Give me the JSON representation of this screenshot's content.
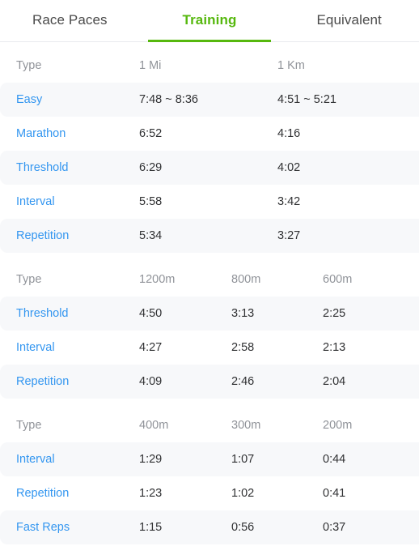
{
  "tabs": [
    {
      "label": "Race Paces",
      "active": false
    },
    {
      "label": "Training",
      "active": true
    },
    {
      "label": "Equivalent",
      "active": false
    }
  ],
  "colors": {
    "accent_green": "#56b80e",
    "link_blue": "#3396f0",
    "header_gray": "#909399",
    "value_dark": "#303133",
    "row_shaded": "#f7f8fa"
  },
  "tables": [
    {
      "columns": 2,
      "headers": [
        "Type",
        "1 Mi",
        "1 Km"
      ],
      "rows": [
        {
          "type": "Easy",
          "values": [
            "7:48 ~ 8:36",
            "4:51 ~ 5:21"
          ]
        },
        {
          "type": "Marathon",
          "values": [
            "6:52",
            "4:16"
          ]
        },
        {
          "type": "Threshold",
          "values": [
            "6:29",
            "4:02"
          ]
        },
        {
          "type": "Interval",
          "values": [
            "5:58",
            "3:42"
          ]
        },
        {
          "type": "Repetition",
          "values": [
            "5:34",
            "3:27"
          ]
        }
      ]
    },
    {
      "columns": 3,
      "headers": [
        "Type",
        "1200m",
        "800m",
        "600m"
      ],
      "rows": [
        {
          "type": "Threshold",
          "values": [
            "4:50",
            "3:13",
            "2:25"
          ]
        },
        {
          "type": "Interval",
          "values": [
            "4:27",
            "2:58",
            "2:13"
          ]
        },
        {
          "type": "Repetition",
          "values": [
            "4:09",
            "2:46",
            "2:04"
          ]
        }
      ]
    },
    {
      "columns": 3,
      "headers": [
        "Type",
        "400m",
        "300m",
        "200m"
      ],
      "rows": [
        {
          "type": "Interval",
          "values": [
            "1:29",
            "1:07",
            "0:44"
          ]
        },
        {
          "type": "Repetition",
          "values": [
            "1:23",
            "1:02",
            "0:41"
          ]
        },
        {
          "type": "Fast Reps",
          "values": [
            "1:15",
            "0:56",
            "0:37"
          ]
        }
      ]
    }
  ]
}
